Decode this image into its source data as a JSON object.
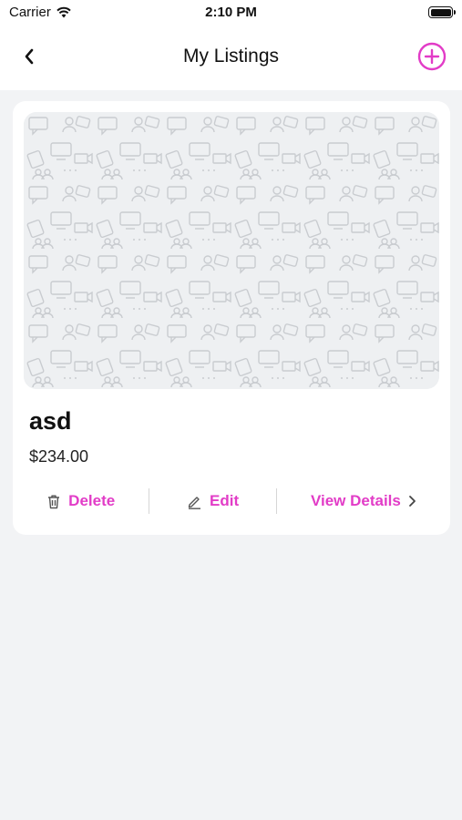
{
  "status_bar": {
    "carrier": "Carrier",
    "time": "2:10 PM"
  },
  "nav": {
    "title": "My Listings",
    "back_icon": "chevron-left-icon",
    "add_icon": "plus-circle-icon"
  },
  "listing": {
    "title": "asd",
    "price": "$234.00",
    "actions": {
      "delete": "Delete",
      "edit": "Edit",
      "view_details": "View Details"
    }
  },
  "colors": {
    "accent": "#e23cc7",
    "background": "#f2f3f5",
    "card": "#ffffff"
  }
}
